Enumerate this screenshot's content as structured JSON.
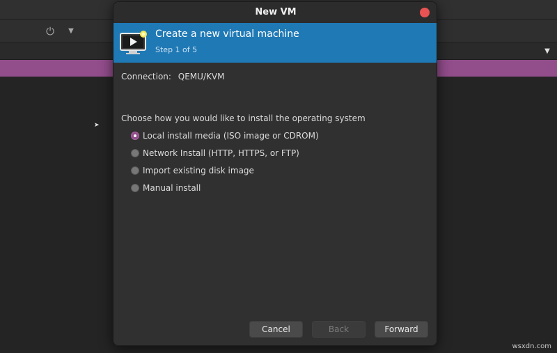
{
  "dialog": {
    "title": "New VM",
    "banner": {
      "title": "Create a new virtual machine",
      "step": "Step 1 of 5"
    },
    "connection": {
      "label": "Connection:",
      "value": "QEMU/KVM"
    },
    "question": "Choose how you would like to install the operating system",
    "options": [
      {
        "label": "Local install media (ISO image or CDROM)",
        "checked": true
      },
      {
        "label": "Network Install (HTTP, HTTPS, or FTP)",
        "checked": false
      },
      {
        "label": "Import existing disk image",
        "checked": false
      },
      {
        "label": "Manual install",
        "checked": false
      }
    ],
    "buttons": {
      "cancel": "Cancel",
      "back": "Back",
      "forward": "Forward"
    }
  },
  "background": {
    "power_icon": "power-icon",
    "selected_row_color": "#924d8b"
  },
  "colors": {
    "accent": "#924d8b",
    "banner": "#1f79b5",
    "close": "#e95353"
  },
  "watermark": "wsxdn.com"
}
